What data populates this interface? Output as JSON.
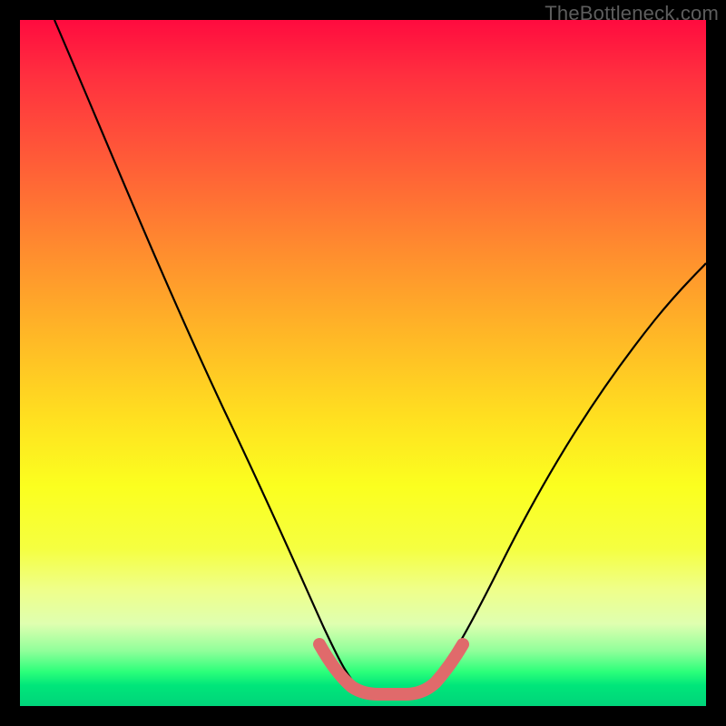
{
  "watermark": "TheBottleneck.com",
  "chart_data": {
    "type": "line",
    "title": "",
    "xlabel": "",
    "ylabel": "",
    "xlim": [
      0,
      100
    ],
    "ylim": [
      0,
      100
    ],
    "series": [
      {
        "name": "bottleneck-curve",
        "x": [
          5,
          10,
          15,
          20,
          25,
          30,
          35,
          40,
          43,
          46,
          50,
          54,
          57,
          60,
          65,
          70,
          75,
          80,
          85,
          90,
          95,
          100
        ],
        "values": [
          100,
          87,
          75,
          64,
          54,
          44,
          35,
          26,
          19,
          12,
          6,
          3,
          3,
          6,
          12,
          19,
          26,
          33,
          40,
          47,
          53,
          60
        ]
      },
      {
        "name": "bottom-highlight",
        "x": [
          43,
          46,
          50,
          54,
          57
        ],
        "values": [
          6,
          3.5,
          2.5,
          3.5,
          6
        ]
      }
    ],
    "colors": {
      "curve": "#000000",
      "highlight": "#e36a6a",
      "gradient_top": "#ff0b3f",
      "gradient_mid": "#ffe020",
      "gradient_bottom": "#00d47a"
    }
  }
}
